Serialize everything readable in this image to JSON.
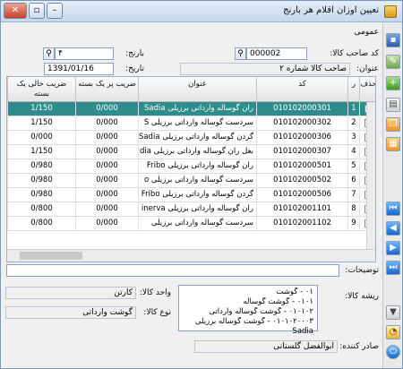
{
  "window": {
    "title": "تعیین اوزان اقلام هر بارنج",
    "buttons": {
      "close": "✕",
      "maximize": "▫",
      "minimize": "–"
    }
  },
  "form": {
    "group_label": "عمومی",
    "product_code_label": "کد صاحب کالا:",
    "product_code_value": "000002",
    "title_label": "عنوان:",
    "title_value": "صاحب کالا شماره ۲",
    "barange_label": "بارنج:",
    "barange_value": "۴",
    "date_label": "تاریخ:",
    "date_value": "1391/01/16"
  },
  "table": {
    "columns": [
      "حذف",
      "ر",
      "کد",
      "عنوان",
      "ضریب پر یک بسته",
      "ضریب خالی یک بسته"
    ],
    "rows": [
      {
        "index": "1",
        "code": "010102000301",
        "title": "ران گوساله وارداتی برزیلی Sadia",
        "full": "0/000",
        "empty": "1/150",
        "selected": true
      },
      {
        "index": "2",
        "code": "010102000302",
        "title": "سردست گوساله وارداتی برزیلی S",
        "full": "0/000",
        "empty": "1/150",
        "selected": false
      },
      {
        "index": "3",
        "code": "010102000306",
        "title": "گردن گوساله وارداتی برزیلی Sadia",
        "full": "0/000",
        "empty": "0/000",
        "selected": false
      },
      {
        "index": "4",
        "code": "010102000307",
        "title": "بغل ران گوساله وارداتی برزیلی dia",
        "full": "0/000",
        "empty": "1/150",
        "selected": false
      },
      {
        "index": "5",
        "code": "010102000501",
        "title": "ران گوساله وارداتی برزیلی Fribo",
        "full": "0/000",
        "empty": "0/980",
        "selected": false
      },
      {
        "index": "6",
        "code": "010102000502",
        "title": "سردست گوساله وارداتی برزیلی o",
        "full": "0/000",
        "empty": "0/980",
        "selected": false
      },
      {
        "index": "7",
        "code": "010102000506",
        "title": "گردن گوساله وارداتی برزیلی Fribo",
        "full": "0/000",
        "empty": "0/980",
        "selected": false
      },
      {
        "index": "8",
        "code": "010102001101",
        "title": "ران گوساله وارداتی برزیلی inerva",
        "full": "0/000",
        "empty": "0/800",
        "selected": false
      },
      {
        "index": "9",
        "code": "010102001102",
        "title": "سردست گوساله وارداتی برزیلی",
        "full": "0/000",
        "empty": "0/800",
        "selected": false
      }
    ]
  },
  "details": {
    "notes_label": "توضیحات:",
    "notes_value": "",
    "unit_label": "واحد کالا:",
    "unit_value": "کارتن",
    "type_label": "نوع کالا:",
    "type_value": "گوشت وارداتی",
    "root_label": "ریشه کالا:",
    "tree": [
      "۰۱ - گوشت",
      "۰۱۰۱ - گوشت گوساله",
      "۰۱۰۱۰۲ - گوشت گوساله وارداتی",
      "۰۱۰۱۰۲۰۰۰۳ - گوشت گوساله برزیلی",
      "Sadia"
    ],
    "issuer_label": "صادر کننده:",
    "issuer_value": "ابوالفضل گلستانی"
  },
  "toolbar": {
    "icons": [
      "save-icon",
      "edit-icon",
      "add-row-icon",
      "document-icon",
      "copy-icon",
      "report-icon",
      "first-record-icon",
      "previous-record-icon",
      "next-record-icon",
      "last-record-icon",
      "filter-icon",
      "chart-icon",
      "power-icon"
    ]
  }
}
